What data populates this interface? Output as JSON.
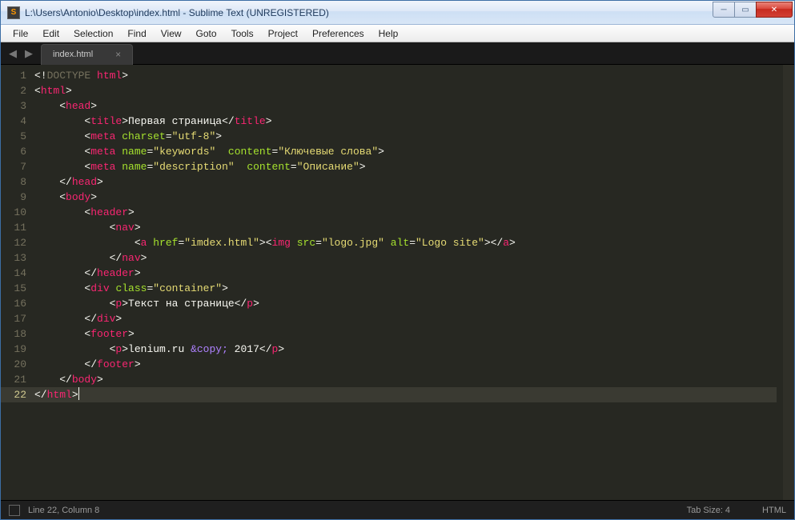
{
  "window": {
    "title": "L:\\Users\\Antonio\\Desktop\\index.html - Sublime Text (UNREGISTERED)"
  },
  "menu": {
    "items": [
      "File",
      "Edit",
      "Selection",
      "Find",
      "View",
      "Goto",
      "Tools",
      "Project",
      "Preferences",
      "Help"
    ]
  },
  "tab": {
    "label": "index.html",
    "close": "×"
  },
  "code": {
    "lines": [
      [
        {
          "c": "p",
          "t": "<!"
        },
        {
          "c": "doctype",
          "t": "DOCTYPE"
        },
        {
          "c": "p",
          "t": " "
        },
        {
          "c": "t",
          "t": "html"
        },
        {
          "c": "p",
          "t": ">"
        }
      ],
      [
        {
          "c": "p",
          "t": "<"
        },
        {
          "c": "t",
          "t": "html"
        },
        {
          "c": "p",
          "t": ">"
        }
      ],
      [
        {
          "c": "p",
          "t": "    <"
        },
        {
          "c": "t",
          "t": "head"
        },
        {
          "c": "p",
          "t": ">"
        }
      ],
      [
        {
          "c": "p",
          "t": "        <"
        },
        {
          "c": "t",
          "t": "title"
        },
        {
          "c": "p",
          "t": ">"
        },
        {
          "c": "tx",
          "t": "Первая страница"
        },
        {
          "c": "p",
          "t": "</"
        },
        {
          "c": "t",
          "t": "title"
        },
        {
          "c": "p",
          "t": ">"
        }
      ],
      [
        {
          "c": "p",
          "t": "        <"
        },
        {
          "c": "t",
          "t": "meta"
        },
        {
          "c": "p",
          "t": " "
        },
        {
          "c": "a",
          "t": "charset"
        },
        {
          "c": "p",
          "t": "="
        },
        {
          "c": "s",
          "t": "\"utf-8\""
        },
        {
          "c": "p",
          "t": ">"
        }
      ],
      [
        {
          "c": "p",
          "t": "        <"
        },
        {
          "c": "t",
          "t": "meta"
        },
        {
          "c": "p",
          "t": " "
        },
        {
          "c": "a",
          "t": "name"
        },
        {
          "c": "p",
          "t": "="
        },
        {
          "c": "s",
          "t": "\"keywords\""
        },
        {
          "c": "p",
          "t": "  "
        },
        {
          "c": "a",
          "t": "content"
        },
        {
          "c": "p",
          "t": "="
        },
        {
          "c": "s",
          "t": "\"Ключевые слова\""
        },
        {
          "c": "p",
          "t": ">"
        }
      ],
      [
        {
          "c": "p",
          "t": "        <"
        },
        {
          "c": "t",
          "t": "meta"
        },
        {
          "c": "p",
          "t": " "
        },
        {
          "c": "a",
          "t": "name"
        },
        {
          "c": "p",
          "t": "="
        },
        {
          "c": "s",
          "t": "\"description\""
        },
        {
          "c": "p",
          "t": "  "
        },
        {
          "c": "a",
          "t": "content"
        },
        {
          "c": "p",
          "t": "="
        },
        {
          "c": "s",
          "t": "\"Описание\""
        },
        {
          "c": "p",
          "t": ">"
        }
      ],
      [
        {
          "c": "p",
          "t": "    </"
        },
        {
          "c": "t",
          "t": "head"
        },
        {
          "c": "p",
          "t": ">"
        }
      ],
      [
        {
          "c": "p",
          "t": "    <"
        },
        {
          "c": "t",
          "t": "body"
        },
        {
          "c": "p",
          "t": ">"
        }
      ],
      [
        {
          "c": "p",
          "t": "        <"
        },
        {
          "c": "t",
          "t": "header"
        },
        {
          "c": "p",
          "t": ">"
        }
      ],
      [
        {
          "c": "p",
          "t": "            <"
        },
        {
          "c": "t",
          "t": "nav"
        },
        {
          "c": "p",
          "t": ">"
        }
      ],
      [
        {
          "c": "p",
          "t": "                <"
        },
        {
          "c": "t",
          "t": "a"
        },
        {
          "c": "p",
          "t": " "
        },
        {
          "c": "a",
          "t": "href"
        },
        {
          "c": "p",
          "t": "="
        },
        {
          "c": "s",
          "t": "\"imdex.html\""
        },
        {
          "c": "p",
          "t": "><"
        },
        {
          "c": "t",
          "t": "img"
        },
        {
          "c": "p",
          "t": " "
        },
        {
          "c": "a",
          "t": "src"
        },
        {
          "c": "p",
          "t": "="
        },
        {
          "c": "s",
          "t": "\"logo.jpg\""
        },
        {
          "c": "p",
          "t": " "
        },
        {
          "c": "a",
          "t": "alt"
        },
        {
          "c": "p",
          "t": "="
        },
        {
          "c": "s",
          "t": "\"Logo site\""
        },
        {
          "c": "p",
          "t": "></"
        },
        {
          "c": "t",
          "t": "a"
        },
        {
          "c": "p",
          "t": ">"
        }
      ],
      [
        {
          "c": "p",
          "t": "            </"
        },
        {
          "c": "t",
          "t": "nav"
        },
        {
          "c": "p",
          "t": ">"
        }
      ],
      [
        {
          "c": "p",
          "t": "        </"
        },
        {
          "c": "t",
          "t": "header"
        },
        {
          "c": "p",
          "t": ">"
        }
      ],
      [
        {
          "c": "p",
          "t": "        <"
        },
        {
          "c": "t",
          "t": "div"
        },
        {
          "c": "p",
          "t": " "
        },
        {
          "c": "a",
          "t": "class"
        },
        {
          "c": "p",
          "t": "="
        },
        {
          "c": "s",
          "t": "\"container\""
        },
        {
          "c": "p",
          "t": ">"
        }
      ],
      [
        {
          "c": "p",
          "t": "            <"
        },
        {
          "c": "t",
          "t": "p"
        },
        {
          "c": "p",
          "t": ">"
        },
        {
          "c": "tx",
          "t": "Текст на странице"
        },
        {
          "c": "p",
          "t": "</"
        },
        {
          "c": "t",
          "t": "p"
        },
        {
          "c": "p",
          "t": ">"
        }
      ],
      [
        {
          "c": "p",
          "t": "        </"
        },
        {
          "c": "t",
          "t": "div"
        },
        {
          "c": "p",
          "t": ">"
        }
      ],
      [
        {
          "c": "p",
          "t": "        <"
        },
        {
          "c": "t",
          "t": "footer"
        },
        {
          "c": "p",
          "t": ">"
        }
      ],
      [
        {
          "c": "p",
          "t": "            <"
        },
        {
          "c": "t",
          "t": "p"
        },
        {
          "c": "p",
          "t": ">"
        },
        {
          "c": "tx",
          "t": "lenium.ru "
        },
        {
          "c": "ent",
          "t": "&copy;"
        },
        {
          "c": "tx",
          "t": " 2017"
        },
        {
          "c": "p",
          "t": "</"
        },
        {
          "c": "t",
          "t": "p"
        },
        {
          "c": "p",
          "t": ">"
        }
      ],
      [
        {
          "c": "p",
          "t": "        </"
        },
        {
          "c": "t",
          "t": "footer"
        },
        {
          "c": "p",
          "t": ">"
        }
      ],
      [
        {
          "c": "p",
          "t": "    </"
        },
        {
          "c": "t",
          "t": "body"
        },
        {
          "c": "p",
          "t": ">"
        }
      ],
      [
        {
          "c": "p",
          "t": "</"
        },
        {
          "c": "t",
          "t": "html"
        },
        {
          "c": "p",
          "t": ">"
        }
      ]
    ],
    "current_line": 22
  },
  "status": {
    "left": "Line 22, Column 8",
    "tab_size": "Tab Size: 4",
    "syntax": "HTML"
  },
  "win_controls": {
    "min": "─",
    "max": "▭",
    "close": "✕"
  },
  "nav": {
    "back": "◀",
    "forward": "▶"
  }
}
